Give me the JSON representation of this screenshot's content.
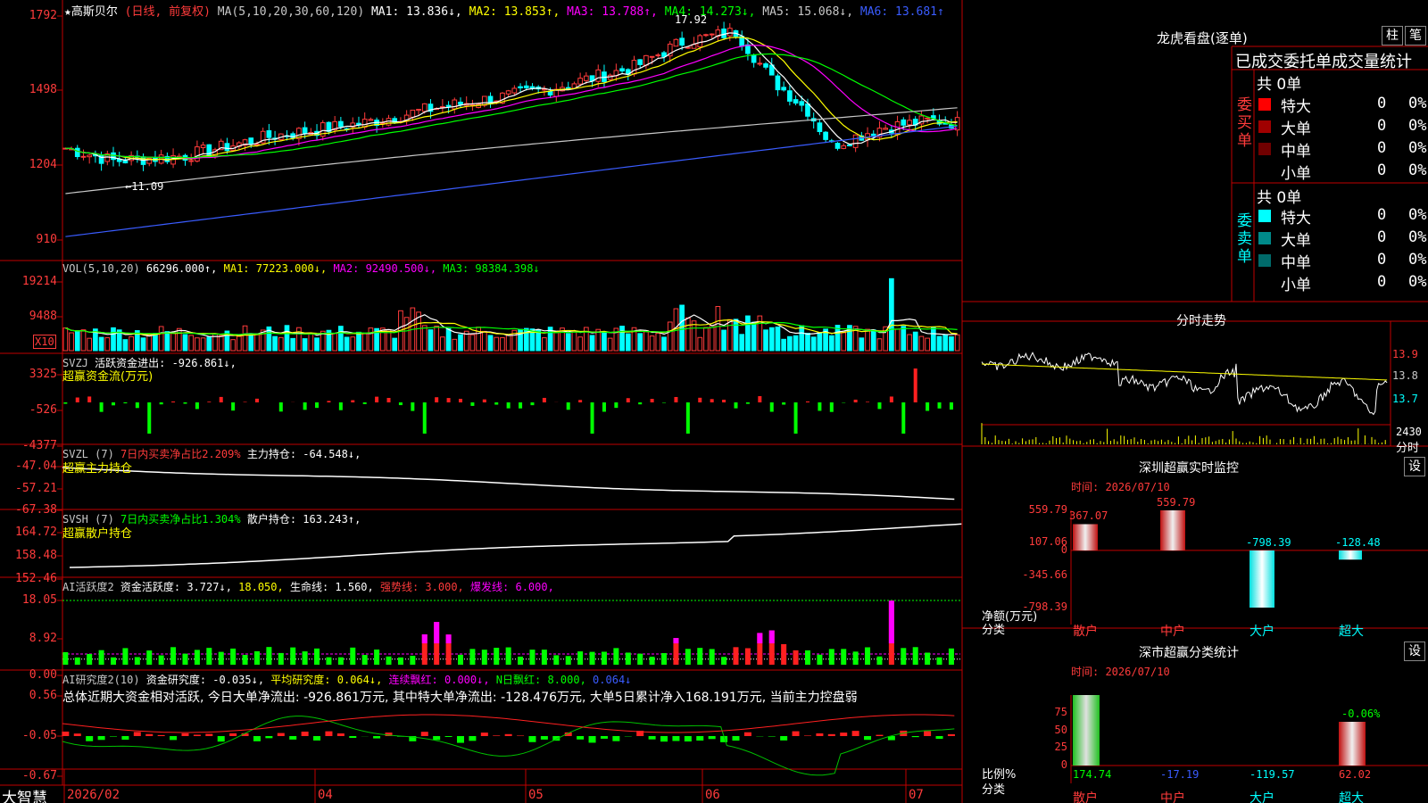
{
  "stock": {
    "name": "★高斯贝尔",
    "mode": "(日线, 前复权)",
    "ma_line": [
      {
        "t": "MA(5,10,20,30,60,120)",
        "c": "#c8c8c8"
      },
      {
        "t": "MA1: 13.836↓,",
        "c": "#ffffff"
      },
      {
        "t": "MA2: 13.853↑,",
        "c": "#ffff00"
      },
      {
        "t": "MA3: 13.788↑,",
        "c": "#ff00ff"
      },
      {
        "t": "MA4: 14.273↓,",
        "c": "#00ff00"
      },
      {
        "t": "MA5: 15.068↓,",
        "c": "#c8c8c8"
      },
      {
        "t": "MA6: 13.681↑",
        "c": "#3a5cff"
      }
    ],
    "high_mark": "17.92",
    "low_mark": "11.09",
    "price_ticks": [
      "1792",
      "1498",
      "1204",
      "910"
    ]
  },
  "vol": {
    "header": [
      {
        "t": "VOL(5,10,20)",
        "c": "#c8c8c8"
      },
      {
        "t": "66296.000↑,",
        "c": "#ffffff"
      },
      {
        "t": "MA1: 77223.000↓,",
        "c": "#ffff00"
      },
      {
        "t": "MA2: 92490.500↓,",
        "c": "#ff00ff"
      },
      {
        "t": "MA3: 98384.398↓",
        "c": "#00ff00"
      }
    ],
    "ticks": [
      "19214",
      "9488"
    ],
    "unit": "X10"
  },
  "svzj": {
    "header": [
      {
        "t": "SVZJ",
        "c": "#c8c8c8"
      },
      {
        "t": "活跃资金进出: -926.861↓,",
        "c": "#ffffff"
      }
    ],
    "subtitle": "超赢资金流(万元)",
    "ticks": [
      "3325",
      "-526",
      "-4377"
    ]
  },
  "svzl": {
    "header": [
      {
        "t": "SVZL (7)",
        "c": "#c8c8c8"
      },
      {
        "t": "7日内买卖净占比2.209%",
        "c": "#ff3b3b"
      },
      {
        "t": "主力持仓: -64.548↓,",
        "c": "#ffffff"
      }
    ],
    "subtitle": "超赢主力持仓",
    "ticks": [
      "-47.04",
      "-57.21",
      "-67.38"
    ]
  },
  "svsh": {
    "header": [
      {
        "t": "SVSH (7)",
        "c": "#c8c8c8"
      },
      {
        "t": "7日内买卖净占比1.304%",
        "c": "#00ff00"
      },
      {
        "t": "散户持仓: 163.243↑,",
        "c": "#ffffff"
      }
    ],
    "subtitle": "超赢散户持仓",
    "ticks": [
      "164.72",
      "158.48",
      "152.46"
    ]
  },
  "ai2": {
    "header": [
      {
        "t": "AI活跃度2",
        "c": "#c8c8c8"
      },
      {
        "t": "资金活跃度: 3.727↓,",
        "c": "#ffffff"
      },
      {
        "t": "18.050,",
        "c": "#ffff00"
      },
      {
        "t": "生命线: 1.560,",
        "c": "#ffffff"
      },
      {
        "t": "强势线: 3.000,",
        "c": "#ff3b3b"
      },
      {
        "t": "爆发线: 6.000,",
        "c": "#ff00ff"
      }
    ],
    "ticks": [
      "18.05",
      "8.92",
      "0.00"
    ]
  },
  "ai_research": {
    "header": [
      {
        "t": "AI研究度2(10)",
        "c": "#c8c8c8"
      },
      {
        "t": "资金研究度: -0.035↓,",
        "c": "#ffffff"
      },
      {
        "t": "平均研究度: 0.064↓,",
        "c": "#ffff00"
      },
      {
        "t": "连续飘红: 0.000↓,",
        "c": "#ff00ff"
      },
      {
        "t": "N日飘红: 8.000,",
        "c": "#00ff00"
      },
      {
        "t": "0.064↓",
        "c": "#3a5cff"
      }
    ],
    "summary": "总体近期大资金相对活跃, 今日大单净流出: -926.861万元, 其中特大单净流出: -128.476万元, 大单5日累计净入168.191万元, 当前主力控盘弱",
    "ticks": [
      "0.56",
      "-0.05",
      "-0.67"
    ]
  },
  "date_axis": {
    "labels": [
      "2026/02",
      "04",
      "05",
      "06",
      "07"
    ],
    "brand": "大智慧"
  },
  "right": {
    "lhkp_title": "龙虎看盘(逐单)",
    "btn_bar": "柱",
    "btn_pen": "笔",
    "order_stats_title": "已成交委托单成交量统计",
    "buy_label": "委买单",
    "sell_label": "委卖单",
    "total_buy": "共 0单",
    "total_sell": "共 0单",
    "buy_rows": [
      {
        "name": "特大",
        "val": "0",
        "pct": "0%",
        "color": "#ff0000"
      },
      {
        "name": "大单",
        "val": "0",
        "pct": "0%",
        "color": "#a00000"
      },
      {
        "name": "中单",
        "val": "0",
        "pct": "0%",
        "color": "#700000"
      },
      {
        "name": "小单",
        "val": "0",
        "pct": "0%",
        "color": ""
      }
    ],
    "sell_rows": [
      {
        "name": "特大",
        "val": "0",
        "pct": "0%",
        "color": "#00ffff"
      },
      {
        "name": "大单",
        "val": "0",
        "pct": "0%",
        "color": "#008a8a"
      },
      {
        "name": "中单",
        "val": "0",
        "pct": "0%",
        "color": "#006a6a"
      },
      {
        "name": "小单",
        "val": "0",
        "pct": "0%",
        "color": ""
      }
    ],
    "intraday_title": "分时走势",
    "intraday_ticks": [
      "13.9",
      "13.8",
      "13.7"
    ],
    "intraday_vol_tick": "2430",
    "intraday_unit": "分时",
    "sz_monitor_title": "深圳超赢实时监控",
    "sz_class_title": "深市超赢分类统计",
    "settings_btn": "设",
    "time_label": "时间: 2026/07/10",
    "monitor_axis": [
      "559.79",
      "107.06",
      "0",
      "-345.66",
      "-798.39"
    ],
    "net_label_1": "净额(万元)",
    "net_label_2": "分类",
    "ratio_label_1": "比例%",
    "ratio_label_2": "分类",
    "ratio_axis": [
      "75",
      "50",
      "25",
      "0"
    ]
  },
  "chart_data": {
    "type": "bar",
    "title": "深圳超赢实时监控",
    "categories": [
      "散户",
      "中户",
      "大户",
      "超大"
    ],
    "values": [
      367.07,
      559.79,
      -798.39,
      -128.48
    ],
    "ylim": [
      -798.39,
      559.79
    ],
    "ratio_values": [
      174.74,
      -17.19,
      -119.57,
      62.02
    ],
    "ratio_pct_mark": "-0.06%"
  }
}
